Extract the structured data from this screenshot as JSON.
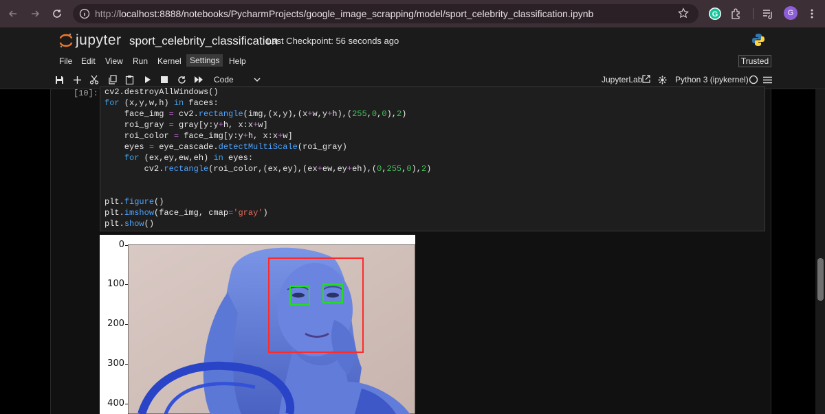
{
  "browser": {
    "url_prefix": "http://",
    "url_host": "localhost",
    "url_rest": ":8888/notebooks/PycharmProjects/google_image_scrapping/model/sport_celebrity_classification.ipynb",
    "avatar_letter": "G"
  },
  "header": {
    "logo_text": "jupyter",
    "notebook_title": "sport_celebrity_classification",
    "checkpoint": "Last Checkpoint: 56 seconds ago"
  },
  "menu": {
    "items": [
      "File",
      "Edit",
      "View",
      "Run",
      "Kernel",
      "Settings",
      "Help"
    ],
    "trusted": "Trusted"
  },
  "toolbar": {
    "cell_type": "Code",
    "jupyterlab_link": "JupyterLab",
    "kernel": "Python 3 (ipykernel)"
  },
  "cell": {
    "prompt": "[10]:",
    "lines": [
      "cv2.destroyAllWindows()",
      "for (x,y,w,h) in faces:",
      "    face_img = cv2.rectangle(img,(x,y),(x+w,y+h),(255,0,0),2)",
      "    roi_gray = gray[y:y+h, x:x+w]",
      "    roi_color = face_img[y:y+h, x:x+w]",
      "    eyes = eye_cascade.detectMultiScale(roi_gray)",
      "    for (ex,ey,ew,eh) in eyes:",
      "        cv2.rectangle(roi_color,(ex,ey),(ex+ew,ey+eh),(0,255,0),2)",
      "",
      "",
      "plt.figure()",
      "plt.imshow(face_img, cmap='gray')",
      "plt.show()"
    ]
  },
  "output": {
    "y_ticks": [
      "0",
      "100",
      "200",
      "300",
      "400"
    ]
  },
  "colors": {
    "face_box": "#ff2a2a",
    "eye_box": "#22dd22",
    "image_tint": "#5e78d8"
  }
}
